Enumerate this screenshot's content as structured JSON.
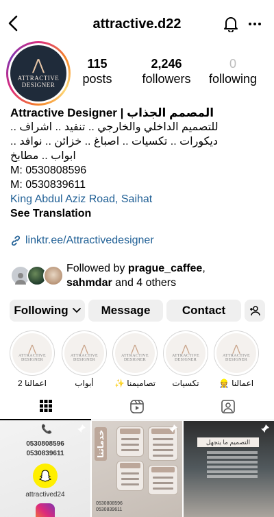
{
  "header": {
    "username": "attractive.d22",
    "back_icon": "chevron-left-icon",
    "bell_icon": "bell-icon",
    "more_icon": "more-horizontal-icon"
  },
  "profile": {
    "avatar_logo_line1": "ATTRACTIVE",
    "avatar_logo_line2": "DESIGNER",
    "stats": {
      "posts_count": "115",
      "posts_label": "posts",
      "followers_count": "2,246",
      "followers_label": "followers",
      "following_count": "0",
      "following_label": "following"
    }
  },
  "bio": {
    "name": "Attractive Designer | المصمم الجذاب",
    "line1": "للتصميم الداخلي والخارجي .. تنفيد .. اشراف ..",
    "line2": "ديكورات .. تكسيات .. اصباغ .. خزائن .. نوافد ..",
    "line3": "ابواب .. مطابخ",
    "phone1": "M: 0530808596",
    "phone2": "M: 0530839611",
    "location": "King Abdul Aziz Road, Saihat",
    "see_translation": "See Translation",
    "link": "linktr.ee/Attractivedesigner"
  },
  "followed_by": {
    "prefix": "Followed by ",
    "user1": "prague_caffee",
    "sep": ",",
    "user2": "sahmdar",
    "suffix": " and 4 others"
  },
  "actions": {
    "following": "Following",
    "message": "Message",
    "contact": "Contact",
    "add_user_icon": "add-user-icon"
  },
  "highlights": [
    {
      "label": "اعمالنا 👷"
    },
    {
      "label": "تكسيات"
    },
    {
      "label": "تصاميمنا ✨"
    },
    {
      "label": "أبواب"
    },
    {
      "label": "اعمالنا 2"
    }
  ],
  "highlight_logo": {
    "line1": "ATTRACTIVE",
    "line2": "DESIGNER"
  },
  "tabs": {
    "grid_icon": "grid-icon",
    "reels_icon": "reels-icon",
    "tagged_icon": "tagged-icon"
  },
  "posts": {
    "post1": {
      "phone1": "0530808596",
      "phone2": "0530839611",
      "handle": "attractived24"
    },
    "post2": {
      "title": "خدماتنا",
      "phone1": "0530808596",
      "phone2": "0530839611"
    },
    "post3": {
      "title": "التصميم ما يتجهل"
    }
  },
  "colors": {
    "link_blue": "#1f5f95",
    "button_bg": "#efefef",
    "avatar_bg": "#1f2b3a"
  }
}
